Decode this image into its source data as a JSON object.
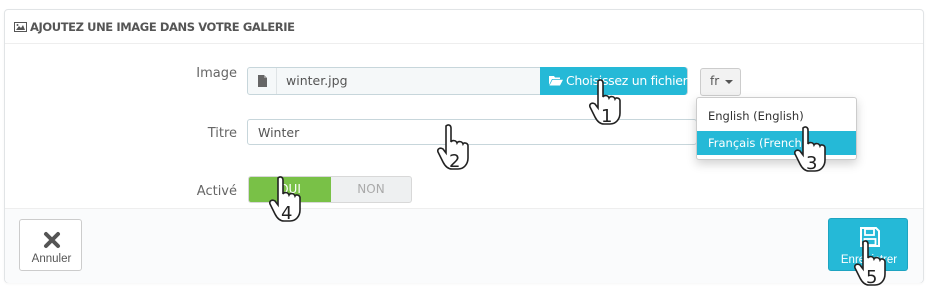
{
  "panel": {
    "heading": "AJOUTEZ UNE IMAGE DANS VOTRE GALERIE",
    "heading_icon": "image-icon"
  },
  "form": {
    "image_label": "Image",
    "file_name": "winter.jpg",
    "choose_button": "Choisissez un fichier",
    "language_selected": "fr",
    "language_options": [
      "English (English)",
      "Français (French)"
    ],
    "language_active": "Français (French)",
    "title_label": "Titre",
    "title_value": "Winter",
    "active_label": "Activé",
    "toggle_yes": "OUI",
    "toggle_no": "NON"
  },
  "footer": {
    "cancel_label": "Annuler",
    "save_label": "Enregistrer"
  },
  "annotations": [
    "1",
    "2",
    "3",
    "4",
    "5"
  ],
  "colors": {
    "accent": "#25b9d7",
    "toggle_on": "#79c147"
  }
}
